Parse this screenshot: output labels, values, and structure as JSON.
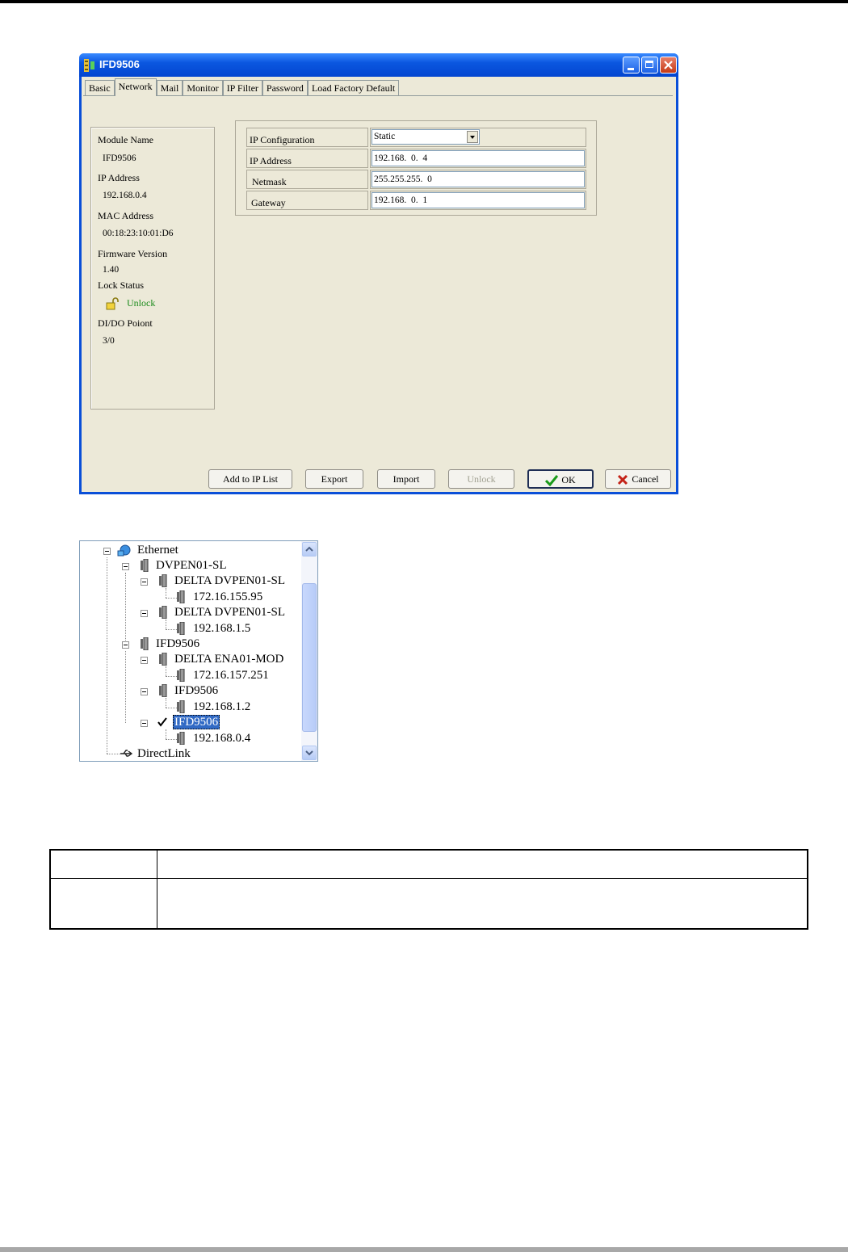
{
  "window": {
    "title": "IFD9506"
  },
  "tabs": [
    "Basic",
    "Network",
    "Mail",
    "Monitor",
    "IP Filter",
    "Password",
    "Load Factory Default"
  ],
  "active_tab": "Network",
  "info": {
    "module_name_label": "Module Name",
    "module_name": "IFD9506",
    "ip_address_label": "IP Address",
    "ip_address": "192.168.0.4",
    "mac_address_label": "MAC Address",
    "mac_address": "00:18:23:10:01:D6",
    "firmware_label": "Firmware Version",
    "firmware": "1.40",
    "lock_status_label": "Lock Status",
    "lock_status": "Unlock",
    "dido_label": "DI/DO Poiont",
    "dido": "3/0"
  },
  "network": {
    "ip_config_label": "IP Configuration",
    "ip_config_value": "Static",
    "ip_address_label": "IP Address",
    "ip_address_value": "192.168.  0.  4",
    "netmask_label": "Netmask",
    "netmask_value": "255.255.255.  0",
    "gateway_label": "Gateway",
    "gateway_value": "192.168.  0.  1"
  },
  "buttons": {
    "add_to_ip_list": "Add to IP List",
    "export": "Export",
    "import": "Import",
    "unlock": "Unlock",
    "ok": "OK",
    "cancel": "Cancel"
  },
  "tree": {
    "ethernet": "Ethernet",
    "dvpen01_sl": "DVPEN01-SL",
    "delta_dvpen01_sl_1": "DELTA DVPEN01-SL",
    "ip_1": "172.16.155.95",
    "delta_dvpen01_sl_2": "DELTA DVPEN01-SL",
    "ip_2": "192.168.1.5",
    "ifd9506_group": "IFD9506",
    "delta_ena01_mod": "DELTA ENA01-MOD",
    "ip_3": "172.16.157.251",
    "ifd9506_1": "IFD9506",
    "ip_4": "192.168.1.2",
    "ifd9506_2": "IFD9506",
    "ip_5": "192.168.0.4",
    "directlink": "DirectLink"
  },
  "colors": {
    "title_bar": "#0a4fd8",
    "dialog_bg": "#ece9d8",
    "unlock_text": "#1a8a1a",
    "selection": "#316ac5"
  },
  "icons": [
    "app-icon",
    "minimize-icon",
    "maximize-icon",
    "close-icon",
    "open-lock-icon",
    "checkmark-icon",
    "cancel-x-icon",
    "network-icon",
    "device-icon",
    "usb-icon"
  ]
}
